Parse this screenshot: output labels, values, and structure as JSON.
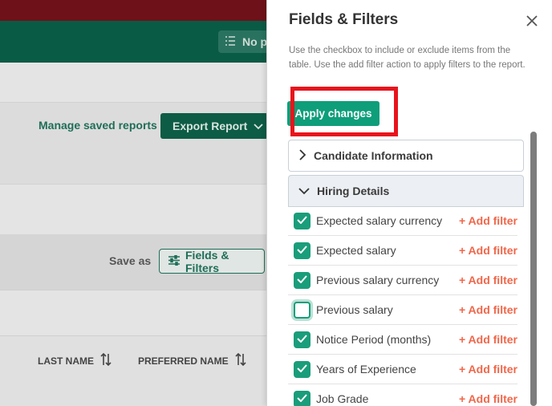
{
  "background": {
    "header_chip_label": "No p",
    "manage_saved_reports": "Manage saved reports",
    "export_report": "Export Report",
    "save_as": "Save as",
    "fields_filters_button": "Fields & Filters",
    "columns": [
      "LAST NAME",
      "PREFERRED NAME"
    ]
  },
  "panel": {
    "title": "Fields & Filters",
    "description": "Use the checkbox to include or exclude items from the table. Use the add filter action to apply filters to the report.",
    "apply_label": "Apply changes",
    "sections": [
      {
        "label": "Candidate Information",
        "expanded": false
      },
      {
        "label": "Hiring Details",
        "expanded": true
      }
    ],
    "add_filter_label": "+ Add filter",
    "fields": [
      {
        "label": "Expected salary currency",
        "checked": true
      },
      {
        "label": "Expected salary",
        "checked": true
      },
      {
        "label": "Previous salary currency",
        "checked": true
      },
      {
        "label": "Previous salary",
        "checked": false
      },
      {
        "label": "Notice Period (months)",
        "checked": true
      },
      {
        "label": "Years of Experience",
        "checked": true
      },
      {
        "label": "Job Grade",
        "checked": true
      }
    ]
  },
  "colors": {
    "brand_green": "#0e9e7a",
    "accent_orange": "#f0674a",
    "highlight_red": "#e8141c"
  }
}
